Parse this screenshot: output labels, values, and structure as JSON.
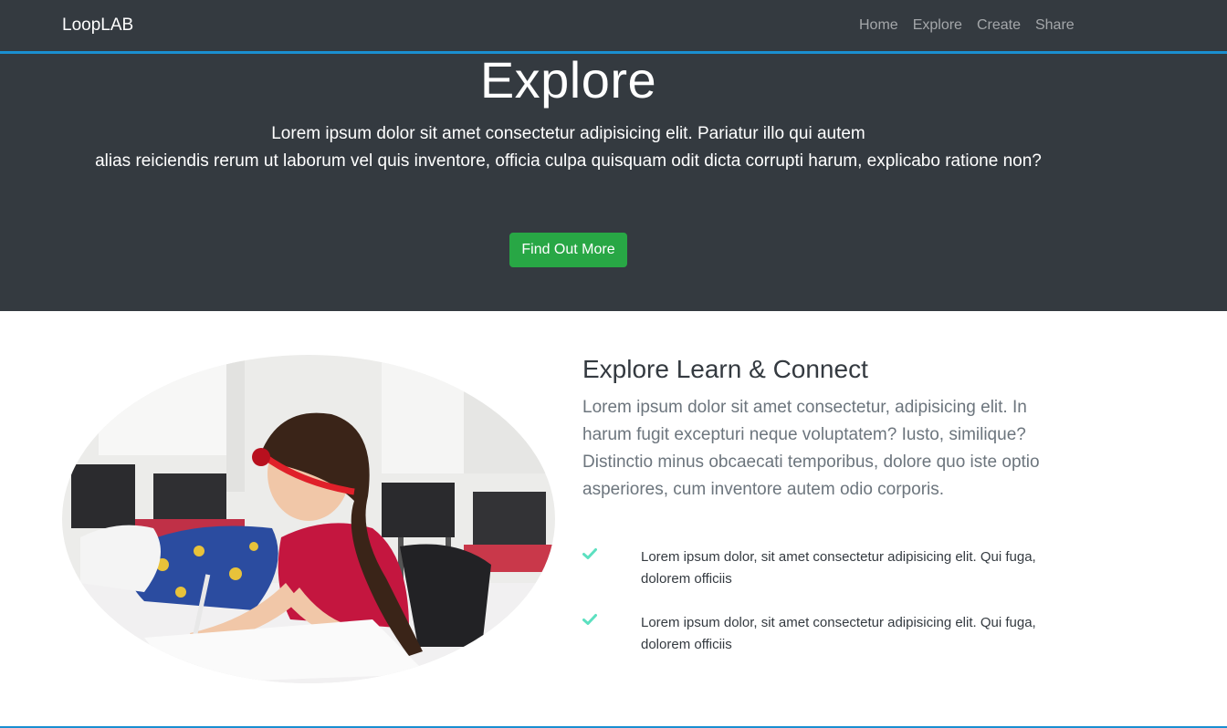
{
  "navbar": {
    "brand": "LoopLAB",
    "links": [
      "Home",
      "Explore",
      "Create",
      "Share"
    ]
  },
  "hero": {
    "title": "Explore",
    "text_line1": "Lorem ipsum dolor sit amet consectetur adipisicing elit. Pariatur illo qui autem",
    "text_line2": "alias reiciendis rerum ut laborum vel quis inventore, officia culpa quisquam odit dicta corrupti harum, explicabo ratione non?",
    "button_label": "Find Out More"
  },
  "section": {
    "title": "Explore Learn & Connect",
    "lead": "Lorem ipsum dolor sit amet consectetur, adipisicing elit. In harum fugit excepturi neque voluptatem? Iusto, similique? Distinctio minus obcaecati temporibus, dolore quo iste optio asperiores, cum inventore autem odio corporis.",
    "features": [
      {
        "icon": "check-icon",
        "text": "Lorem ipsum dolor, sit amet consectetur adipisicing elit. Qui fuga, dolorem officiis"
      },
      {
        "icon": "check-icon",
        "text": "Lorem ipsum dolor, sit amet consectetur adipisicing elit. Qui fuga, dolorem officiis"
      }
    ]
  },
  "colors": {
    "navbar_bg": "#343a40",
    "accent_border": "#1a8fd1",
    "button_green": "#28a745",
    "check_color": "#5ce0c0"
  }
}
